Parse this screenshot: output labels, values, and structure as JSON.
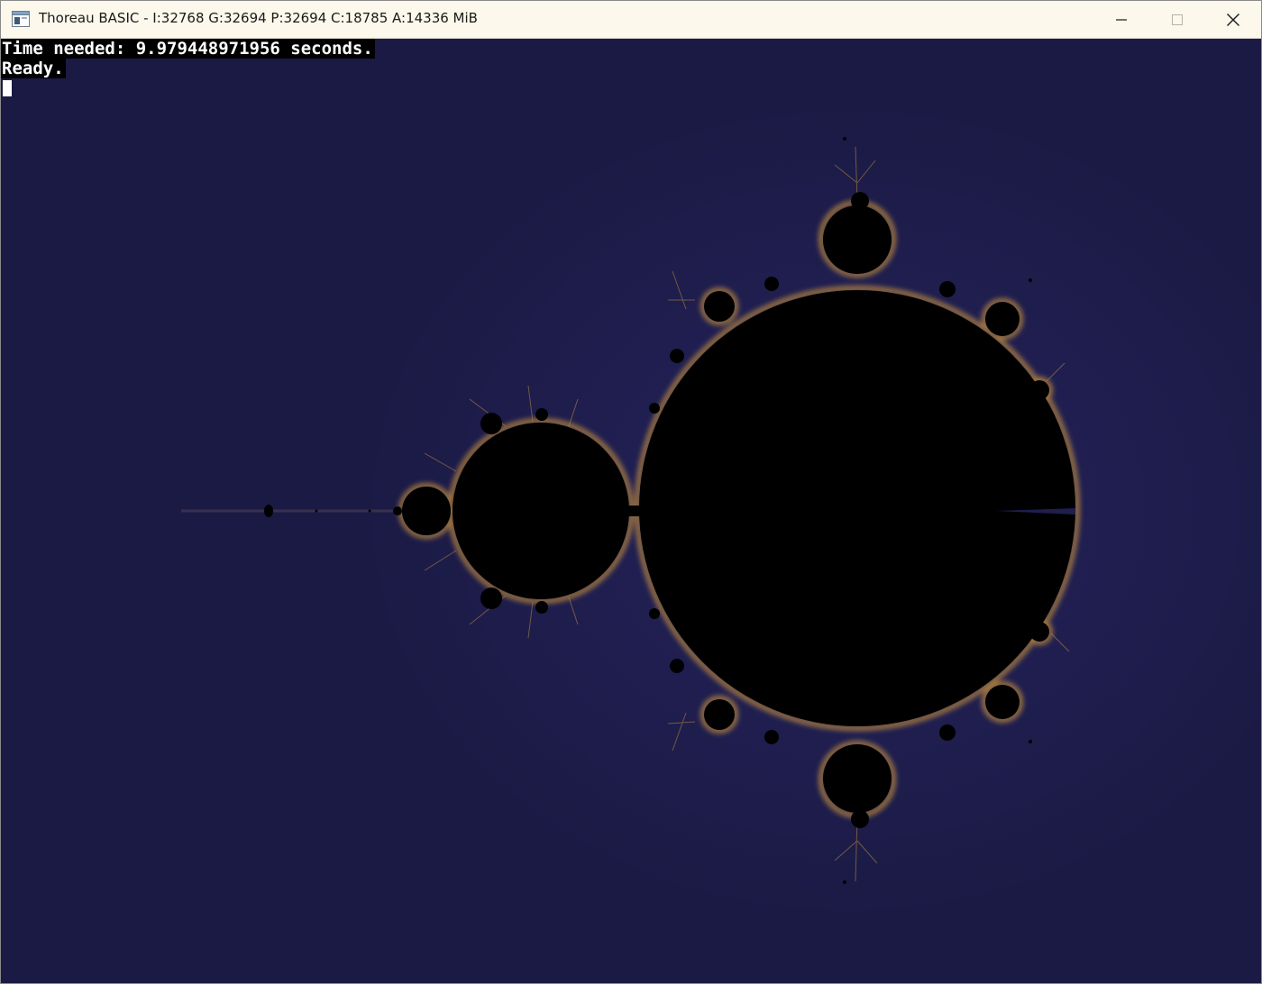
{
  "window": {
    "title": "Thoreau BASIC - I:32768 G:32694 P:32694 C:18785 A:14336 MiB",
    "app_icon": "console-window-icon",
    "controls": {
      "minimize": "minimize-icon",
      "maximize": "maximize-icon",
      "close": "close-icon"
    }
  },
  "console": {
    "lines": [
      "Time needed: 9.979448971956 seconds.",
      "Ready."
    ],
    "cursor": "block-cursor"
  },
  "colors": {
    "background": "#1b1a45",
    "set_fill": "#000000",
    "edge_glow": "#c8923a",
    "titlebar": "#fcf8ec",
    "console_text": "#ffffff",
    "console_bg": "#000000"
  }
}
